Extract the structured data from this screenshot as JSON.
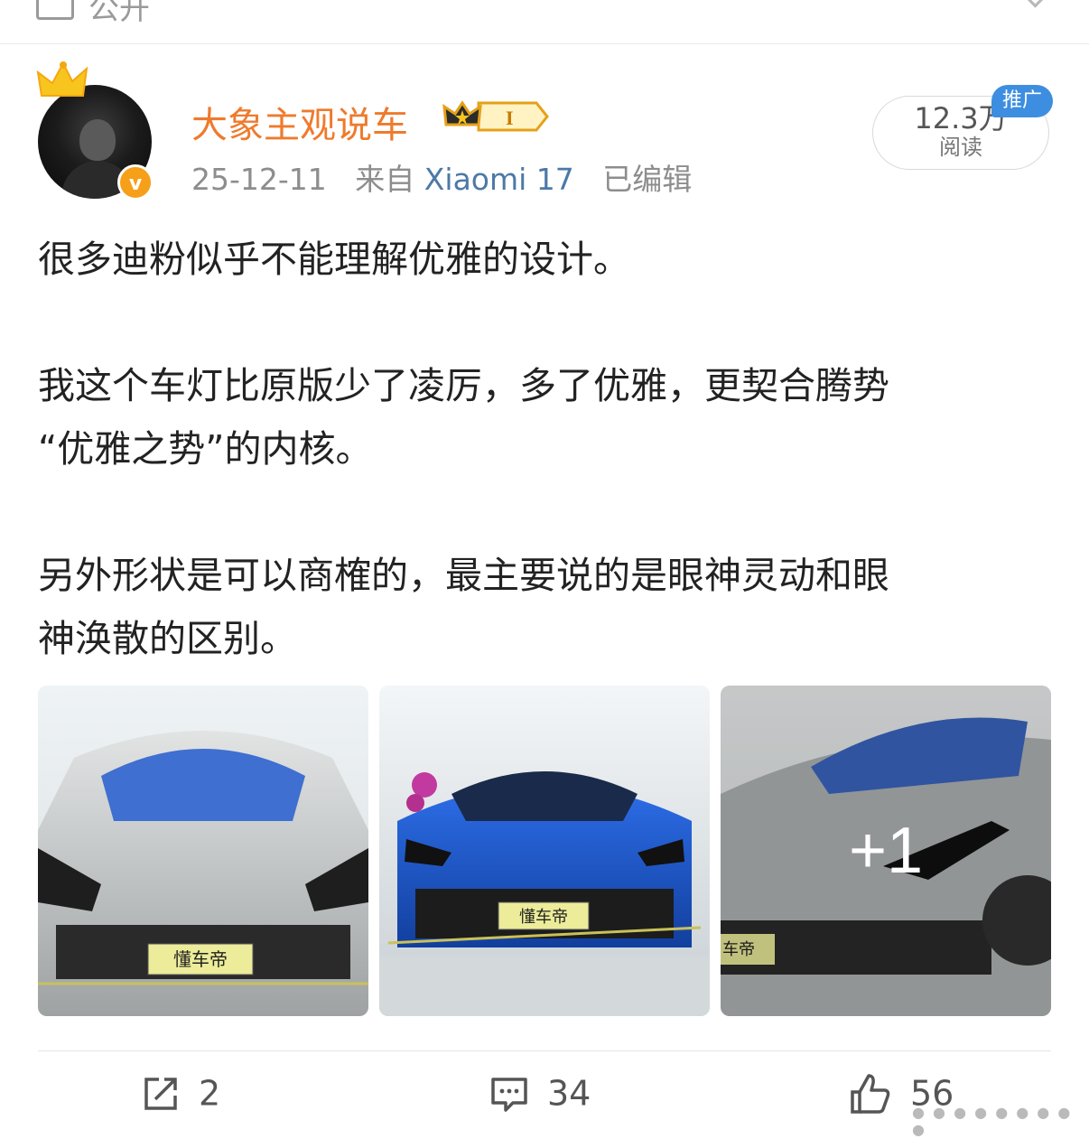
{
  "topbar": {
    "visibility": "公开"
  },
  "post": {
    "author": "大象主观说车",
    "vip_level": "I",
    "date": "25-12-11",
    "source_prefix": "来自",
    "device": "Xiaomi 17",
    "edited": "已编辑",
    "reads": {
      "count": "12.3万",
      "label": "阅读"
    },
    "promo_tag": "推广",
    "paragraphs": [
      "很多迪粉似乎不能理解优雅的设计。",
      "我这个车灯比原版少了凌厉，多了优雅，更契合腾势",
      "“优雅之势”的内核。",
      "另外形状是可以商榷的，最主要说的是眼神灵动和眼",
      "神涣散的区别。"
    ],
    "images": [
      {
        "desc": "silver sports car front",
        "badge": "懂车帝"
      },
      {
        "desc": "blue sports car front",
        "badge": "懂车帝"
      },
      {
        "desc": "grey sports car three-quarter",
        "badge": "车帝"
      }
    ],
    "more_images": "+1",
    "actions": {
      "reposts": "2",
      "comments": "34",
      "likes": "56"
    }
  },
  "colors": {
    "accent": "#ef7a2c",
    "link": "#4c79a8",
    "promo": "#3d8ee0"
  }
}
